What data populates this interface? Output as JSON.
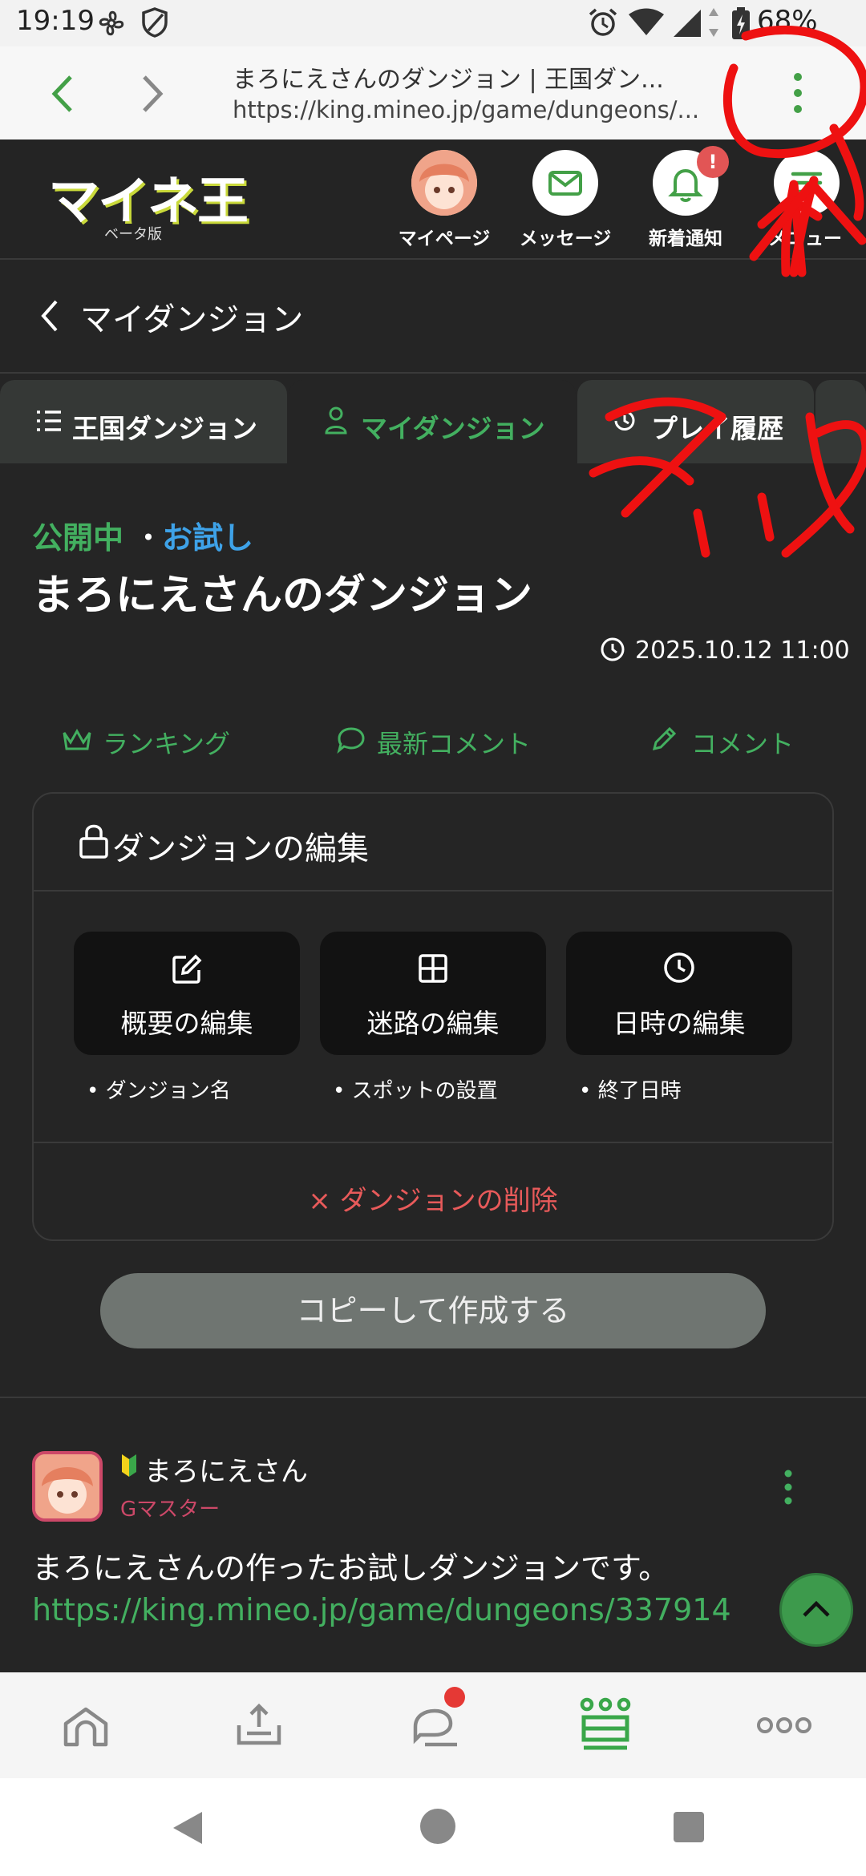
{
  "statusbar": {
    "time": "19:19",
    "battery": "68%"
  },
  "browser": {
    "page_title": "まろにえさんのダンジョン | 王国ダン...",
    "url": "https://king.mineo.jp/game/dungeons/..."
  },
  "header": {
    "logo": "マイネ王",
    "logo_sub": "ベータ版",
    "mypage_label": "マイページ",
    "message_label": "メッセージ",
    "notify_label": "新着通知",
    "notify_badge": "!",
    "menu_label": "メニュー"
  },
  "back": {
    "label": "マイダンジョン"
  },
  "tabs": [
    {
      "label": "王国ダンジョン"
    },
    {
      "label": "マイダンジョン"
    },
    {
      "label": "プレイ履歴"
    }
  ],
  "dungeon": {
    "status_public": "公開中",
    "separator": "・",
    "status_trial": "お試し",
    "title": "まろにえさんのダンジョン",
    "date": "2025.10.12 11:00"
  },
  "links": {
    "ranking": "ランキング",
    "latest_comment": "最新コメント",
    "comment": "コメント"
  },
  "edit_card": {
    "title": "ダンジョンの編集",
    "buttons": [
      {
        "label": "概要の編集",
        "note": "ダンジョン名"
      },
      {
        "label": "迷路の編集",
        "note": "スポットの設置"
      },
      {
        "label": "日時の編集",
        "note": "終了日時"
      }
    ],
    "delete_label": "× ダンジョンの削除"
  },
  "copy_button": "コピーして作成する",
  "post": {
    "username": "まろにえさん",
    "role": "Gマスター",
    "body": "まろにえさんの作ったお試しダンジョンです。",
    "link": "https://king.mineo.jp/game/dungeons/337914"
  },
  "annotation": {
    "text": "タップ",
    "color": "#ee1111"
  },
  "colors": {
    "accent_green": "#43b060",
    "trial_blue": "#3ea2e8",
    "danger_red": "#e85a5a",
    "background": "#252525"
  }
}
